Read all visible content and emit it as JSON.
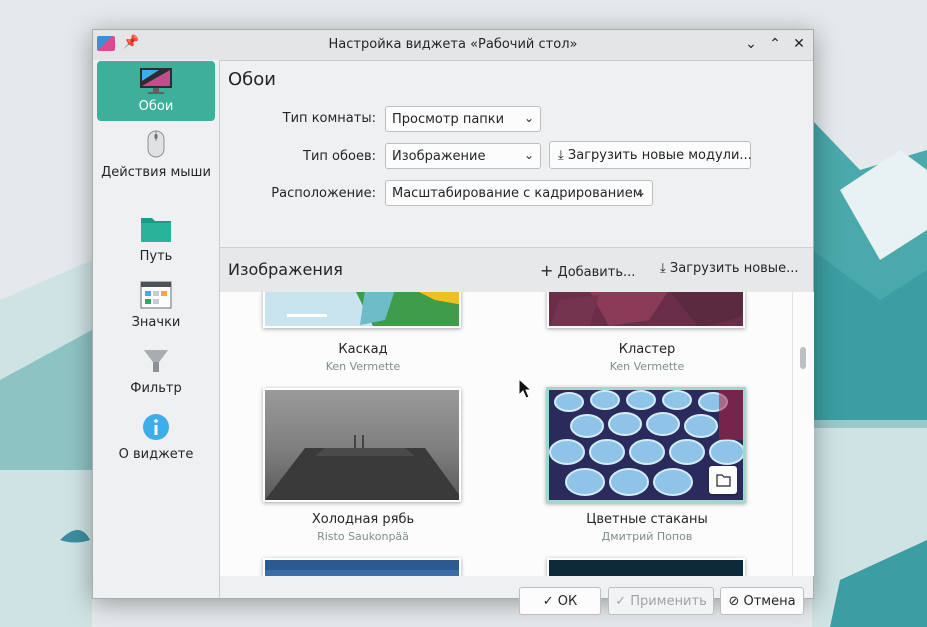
{
  "window": {
    "title": "Настройка виджета «Рабочий стол»",
    "app_icon": "plasma-desktop-icon",
    "pin_icon": "pin-icon",
    "controls": [
      "minimize-icon",
      "maximize-icon",
      "close-icon"
    ]
  },
  "sidebar": {
    "items": [
      {
        "label": "Обои",
        "icon": "monitor-icon",
        "active": true
      },
      {
        "label": "Действия мыши",
        "icon": "mouse-icon"
      },
      {
        "label": "Путь",
        "icon": "folder-icon"
      },
      {
        "label": "Значки",
        "icon": "icons-view-icon"
      },
      {
        "label": "Фильтр",
        "icon": "filter-icon"
      },
      {
        "label": "О виджете",
        "icon": "info-icon"
      }
    ]
  },
  "main": {
    "title": "Обои",
    "layout_label": "Тип комнаты:",
    "layout_value": "Просмотр папки",
    "wallpaper_type_label": "Тип обоев:",
    "wallpaper_type_value": "Изображение",
    "get_plugins_button": "Загрузить новые модули...",
    "positioning_label": "Расположение:",
    "positioning_value": "Масштабирование с кадрированием",
    "images_title": "Изображения",
    "add_button": "Добавить...",
    "get_new_button": "Загрузить новые...",
    "wallpapers": [
      {
        "name": "Каскад",
        "author": "Ken Vermette"
      },
      {
        "name": "Кластер",
        "author": "Ken Vermette"
      },
      {
        "name": "Холодная рябь",
        "author": "Risto Saukonpää"
      },
      {
        "name": "Цветные стаканы",
        "author": "Дмитрий Попов",
        "selected": true
      }
    ]
  },
  "buttons": {
    "ok": "ОК",
    "apply": "Применить",
    "cancel": "Отмена"
  },
  "colors": {
    "accent": "#3daf9a",
    "selection_border": "#9fd8cd"
  }
}
